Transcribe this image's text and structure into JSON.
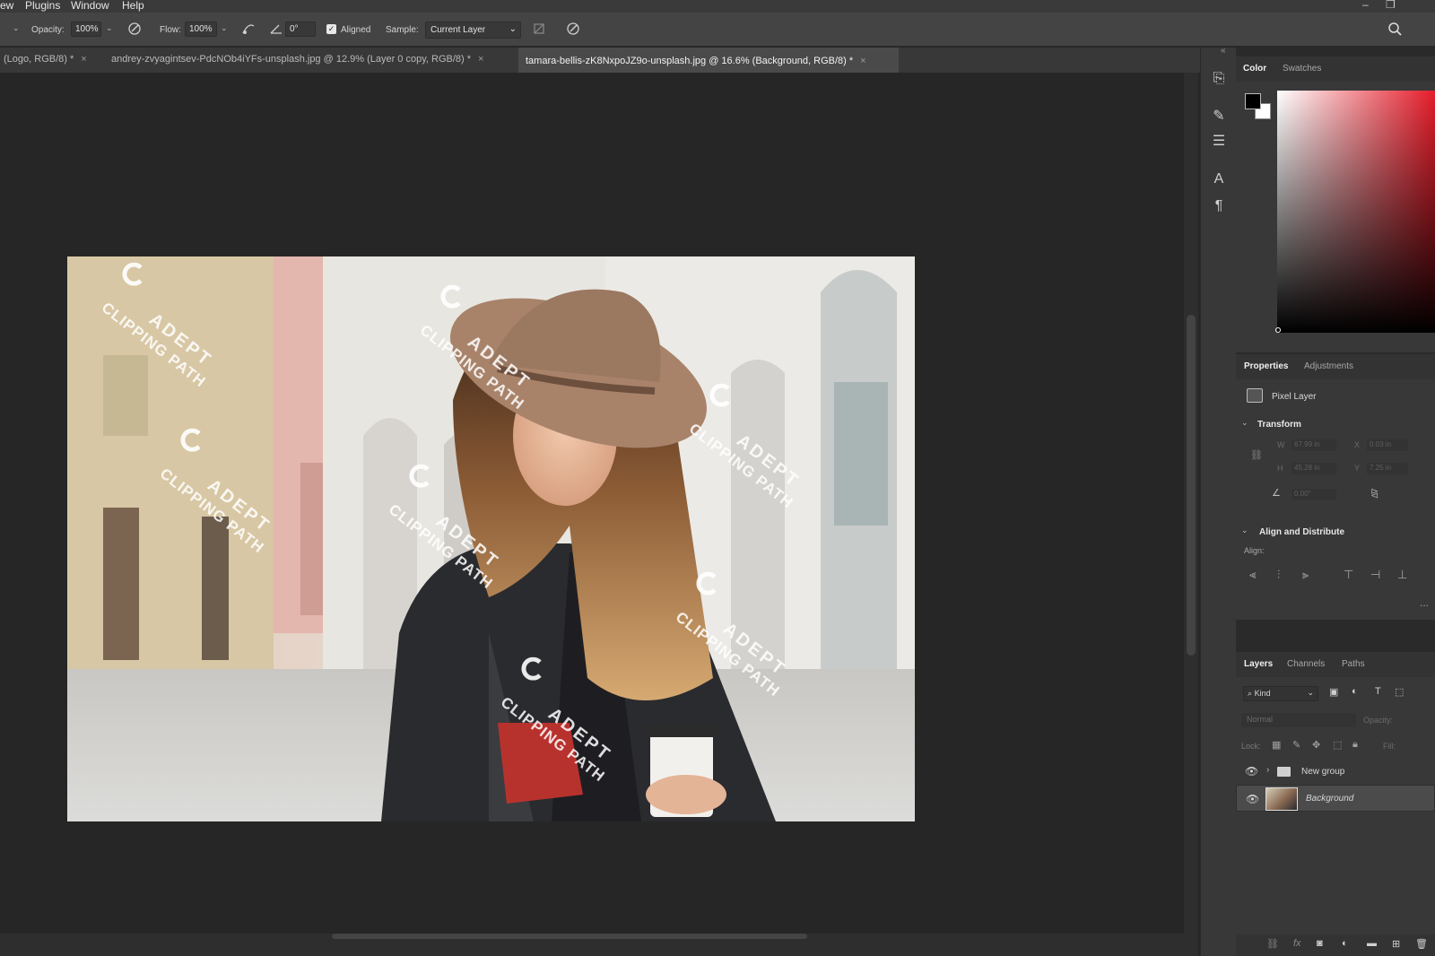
{
  "menu": {
    "items": [
      "ew",
      "Plugins",
      "Window",
      "Help"
    ]
  },
  "options": {
    "opacity_label": "Opacity:",
    "opacity_value": "100%",
    "flow_label": "Flow:",
    "flow_value": "100%",
    "angle_value": "0°",
    "aligned_label": "Aligned",
    "aligned_checked": true,
    "sample_label": "Sample:",
    "sample_value": "Current Layer"
  },
  "tabs": [
    {
      "label": "(Logo, RGB/8) *",
      "close": "×"
    },
    {
      "label": "andrey-zvyagintsev-PdcNOb4iYFs-unsplash.jpg @ 12.9% (Layer 0 copy, RGB/8) *",
      "close": "×"
    },
    {
      "label": "tamara-bellis-zK8NxpoJZ9o-unsplash.jpg @ 16.6% (Background, RGB/8) *",
      "close": "×",
      "active": true
    }
  ],
  "canvas": {
    "watermark_line1": "ADEPT",
    "watermark_line2": "CLIPPING PATH"
  },
  "color_panel": {
    "tabs": [
      "Color",
      "Swatches"
    ],
    "foreground": "#000000",
    "background": "#ffffff",
    "hue": "#e51d2a"
  },
  "properties_panel": {
    "tabs": [
      "Properties",
      "Adjustments"
    ],
    "layer_type": "Pixel Layer",
    "transform_title": "Transform",
    "fields": {
      "w_label": "W",
      "w_value": "67.99 in",
      "h_label": "H",
      "h_value": "45.28 in",
      "x_label": "X",
      "x_value": "0.03 in",
      "y_label": "Y",
      "y_value": "7.25 in",
      "angle_value": "0.00°"
    },
    "align_title": "Align and Distribute",
    "align_label": "Align:",
    "more": "..."
  },
  "layers_panel": {
    "tabs": [
      "Layers",
      "Channels",
      "Paths"
    ],
    "filter_label": "Kind",
    "blend_mode": "Normal",
    "opacity_label": "Opacity:",
    "lock_label": "Lock:",
    "fill_label": "Fill:",
    "layers": [
      {
        "name": "New group",
        "type": "group",
        "visible": true,
        "selected": false
      },
      {
        "name": "Background",
        "type": "pixel",
        "visible": true,
        "selected": true
      }
    ],
    "footer_icons": [
      "link-icon",
      "fx-icon",
      "mask-icon",
      "adjustment-icon",
      "folder-icon",
      "new-layer-icon"
    ]
  }
}
